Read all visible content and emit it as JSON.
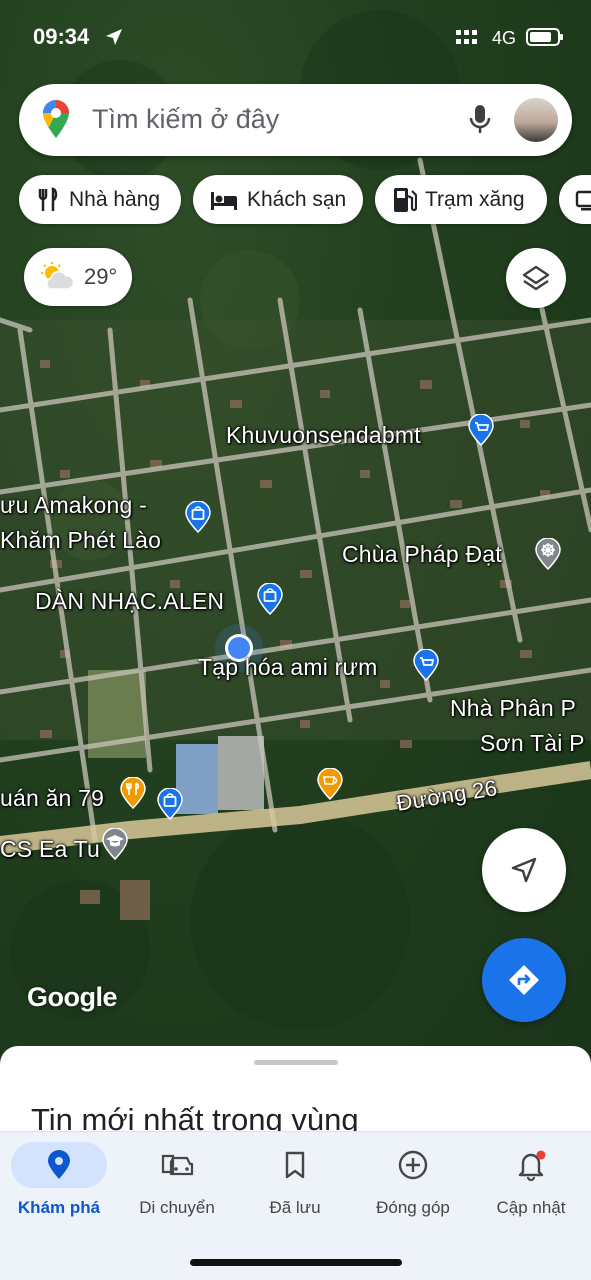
{
  "status_bar": {
    "time": "09:34",
    "network": "4G",
    "battery_percent": 80
  },
  "search": {
    "placeholder": "Tìm kiếm ở đây"
  },
  "chips": [
    {
      "label": "Nhà hàng",
      "icon": "fork-knife-icon"
    },
    {
      "label": "Khách sạn",
      "icon": "bed-icon"
    },
    {
      "label": "Trạm xăng",
      "icon": "gas-pump-icon"
    }
  ],
  "weather": {
    "temp": "29°",
    "icon": "partly-cloudy-icon"
  },
  "map_labels": {
    "khuvuon": "Khuvuonsendabmt",
    "amakong_1": "ưu Amakong -",
    "amakong_2": "Khăm Phét Lào",
    "chua": "Chùa Pháp Đạt",
    "dannhac": "DÀN NHẠC.ALEN",
    "taphoa": "Tạp hóa ami rưm",
    "nhaphan_1": "Nhà Phân P",
    "nhaphan_2": "Sơn Tài P",
    "quanan": "uán ăn 79",
    "duong": "Đường 26",
    "school": "CS Ea Tu"
  },
  "map_brand": "Google",
  "sheet": {
    "title": "Tin mới nhất trong vùng"
  },
  "nav": [
    {
      "label": "Khám phá",
      "icon": "location-pin-icon",
      "active": true
    },
    {
      "label": "Di chuyển",
      "icon": "car-icon",
      "active": false
    },
    {
      "label": "Đã lưu",
      "icon": "bookmark-icon",
      "active": false
    },
    {
      "label": "Đóng góp",
      "icon": "add-circle-icon",
      "active": false
    },
    {
      "label": "Cập nhật",
      "icon": "bell-icon",
      "active": false
    }
  ],
  "colors": {
    "accent": "#1a73e8",
    "shop_pin": "#1a73e8",
    "food_pin": "#f29900",
    "temple_pin": "#80868b",
    "notification_dot": "#ea4335"
  }
}
